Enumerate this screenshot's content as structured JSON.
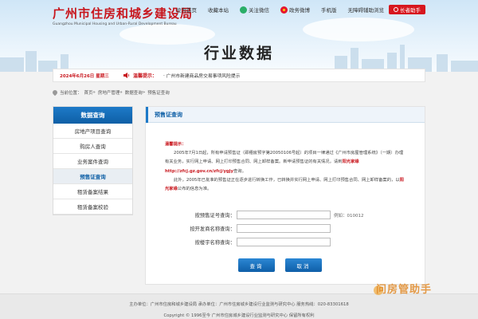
{
  "header": {
    "logo_title": "广州市住房和城乡建设局",
    "logo_subtitle": "Guangzhou Municipal Housing and Urban-Rural Development Bureau",
    "nav": {
      "home": "设为首页",
      "favorite": "收藏本站",
      "wechat": "关注微信",
      "weibo": "政务微博",
      "mobile": "手机版",
      "accessible": "无障碍辅助浏览",
      "elder_helper": "长者助手"
    },
    "page_title": "行业数据"
  },
  "notice": {
    "date": "2024年6月26日 星期三",
    "label": "温馨提示：",
    "text": "· 广州市新建商品房交易事项风险提示"
  },
  "breadcrumb": {
    "prefix": "当前位置：",
    "items": [
      "首页",
      "房地产管理",
      "数据查询",
      "预售证查询"
    ],
    "sep": "»"
  },
  "sidebar": {
    "header": "数据查询",
    "items": [
      "房地产项目查询",
      "购房人查询",
      "业务案件查询",
      "预售证查询",
      "租赁备案结果",
      "租赁备案校验"
    ],
    "active_index": 3
  },
  "main": {
    "title": "预售证查询",
    "tips": {
      "title": "温馨提示：",
      "p1_a": "2005年7月1日起，所有申请预售证（即穗房预字第20050106号起）的项目一律通过《广州市房屋管理系统》（一期）办理有关业务，实行网上申请、网上打印预售合同、网上卸样备案。新申请预售证的有关情况，请到",
      "p1_link_name": "阳光家缘",
      "p1_link_url": "http://zfcj.gz.gov.cn/zfcj/ygjy",
      "p1_b": "查询。",
      "p2_a": "此外，2005年已批准的预售证正在逐步进行转换工作，已转换并实行网上申请、网上打印预售合同、网上卸样备案的，以",
      "p2_link_name": "阳光家缘",
      "p2_b": "公布的信息为准。"
    },
    "form": {
      "permit_label": "按预售证号查询：",
      "permit_value": "",
      "permit_hint": "例如：010012",
      "developer_label": "按开发商名称查询：",
      "developer_value": "",
      "building_label": "按楼宇名称查询：",
      "building_value": ""
    },
    "buttons": {
      "search": "查询",
      "cancel": "取消"
    }
  },
  "footer": {
    "line1": "主办单位：广州市住房和城乡建设局  承办单位：广州市住房城乡建设行业监测与研究中心  服务热线：020-83301618",
    "line2": "Copyright © 1996至今 广州市住房城乡建设行业监测与研究中心 保留所有权利"
  },
  "watermark": "问房管助手",
  "colors": {
    "brand_red": "#c8161d",
    "primary_blue": "#0e5fa6",
    "sidebar_active_bg": "#e9eef3"
  }
}
